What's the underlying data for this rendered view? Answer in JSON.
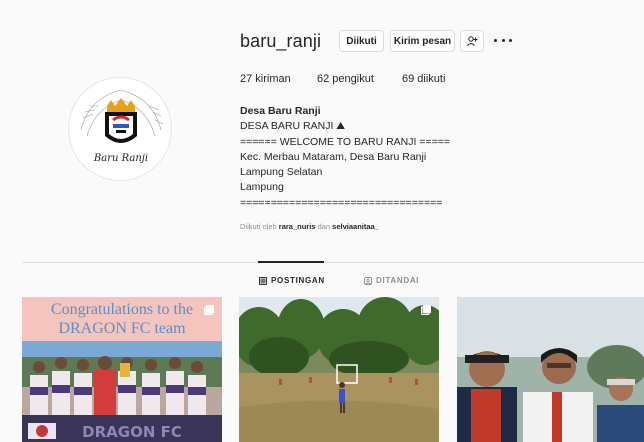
{
  "profile": {
    "username": "baru_ranji",
    "avatar_logo_text": "Baru Ranji",
    "buttons": {
      "following": "Diikuti",
      "message": "Kirim pesan"
    },
    "icons": {
      "suggest": "add-person-icon",
      "more": "more-options-icon"
    },
    "stats": {
      "posts": "27 kiriman",
      "followers": "62 pengikut",
      "following": "69 diikuti"
    },
    "bio": {
      "name": "Desa Baru Ranji",
      "lines": [
        "DESA BARU RANJI ⛰",
        "====== WELCOME TO BARU RANJI =====",
        "Kec. Merbau Mataram, Desa Baru Ranji",
        "Lampung Selatan",
        "Lampung",
        "================================="
      ]
    },
    "followed_by": {
      "prefix": "Diikuti oleh",
      "user1": "rara_nuris",
      "joiner": "dan",
      "user2": "selviaanitaa_"
    }
  },
  "tabs": [
    {
      "label": "POSTINGAN",
      "icon": "grid-icon",
      "active": true
    },
    {
      "label": "DITANDAI",
      "icon": "tag-user-icon",
      "active": false
    }
  ],
  "posts": [
    {
      "caption_line1": "Congratulations to the",
      "caption_line2": "DRAGON FC team",
      "footer_text": "DRAGON FC",
      "multi": true
    },
    {
      "multi": true
    },
    {
      "multi": false
    }
  ],
  "colors": {
    "background": "#fafafa",
    "text": "#262626",
    "muted": "#8e8e8e",
    "border": "#dbdbdb",
    "caption_blue": "#5a8fc8"
  }
}
